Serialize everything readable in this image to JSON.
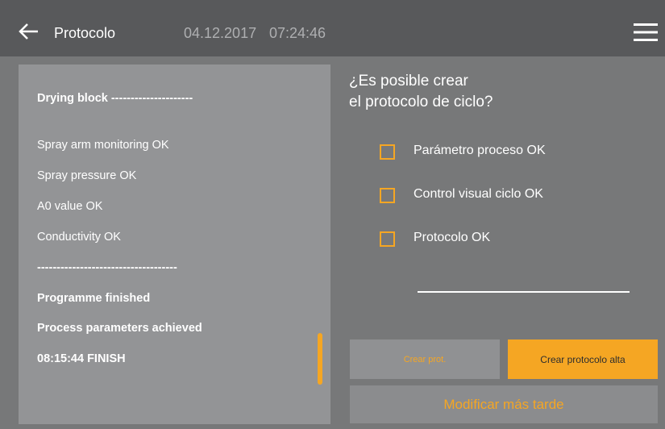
{
  "header": {
    "title": "Protocolo",
    "date": "04.12.2017",
    "time": "07:24:46",
    "back_icon": "arrow-left-icon",
    "menu_icon": "hamburger-menu-icon"
  },
  "log": {
    "lines": [
      {
        "text": "Drying block ---------------------",
        "bold": true
      },
      {
        "text": "Spray arm monitoring OK",
        "bold": false
      },
      {
        "text": "Spray pressure OK",
        "bold": false
      },
      {
        "text": "A0 value OK",
        "bold": false
      },
      {
        "text": "Conductivity OK",
        "bold": false
      },
      {
        "text": "------------------------------------",
        "bold": true
      },
      {
        "text": "Programme finished",
        "bold": true
      },
      {
        "text": "Process parameters achieved",
        "bold": true
      },
      {
        "text": "08:15:44 FINISH",
        "bold": true
      }
    ]
  },
  "question": {
    "line1": "¿Es posible crear",
    "line2": "el protocolo de ciclo?"
  },
  "checks": [
    {
      "label": "Parámetro proceso OK",
      "checked": false
    },
    {
      "label": "Control visual ciclo OK",
      "checked": false
    },
    {
      "label": "Protocolo OK",
      "checked": false
    }
  ],
  "buttons": {
    "crear": "Crear prot.",
    "crear_alta": "Crear protocolo alta",
    "modificar": "Modificar más tarde"
  },
  "colors": {
    "accent": "#f5a623",
    "header_bg": "#58595b",
    "panel_bg": "#939496",
    "main_bg": "#777879"
  }
}
